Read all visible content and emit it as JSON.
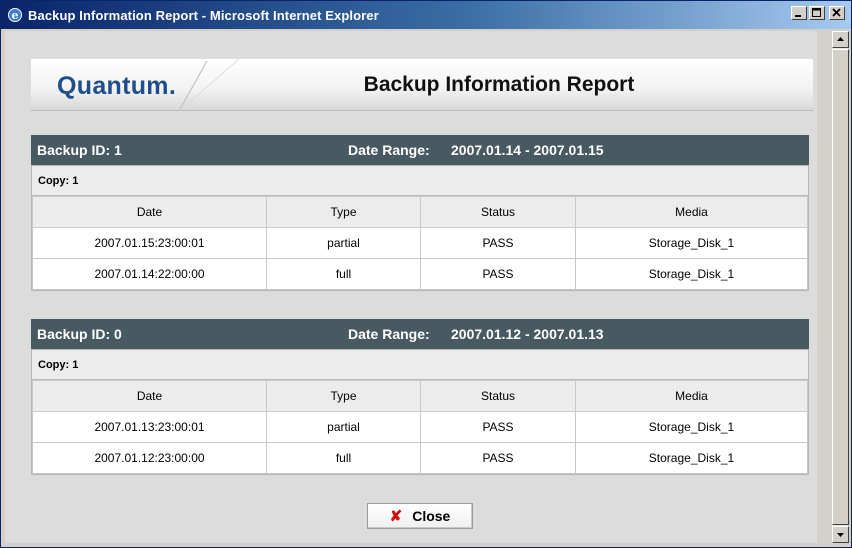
{
  "window": {
    "title": "Backup Information Report - Microsoft Internet Explorer",
    "icon": "ie-icon",
    "controls": [
      "minimize-icon",
      "maximize-icon",
      "close-icon"
    ]
  },
  "header": {
    "logo_text": "Quantum.",
    "report_title": "Backup Information Report"
  },
  "backups": [
    {
      "id_label": "Backup ID: 1",
      "range_label": "Date Range:",
      "range_value": "2007.01.14 - 2007.01.15",
      "copy_label": "Copy: 1",
      "columns": [
        "Date",
        "Type",
        "Status",
        "Media"
      ],
      "rows": [
        [
          "2007.01.15:23:00:01",
          "partial",
          "PASS",
          "Storage_Disk_1"
        ],
        [
          "2007.01.14:22:00:00",
          "full",
          "PASS",
          "Storage_Disk_1"
        ]
      ]
    },
    {
      "id_label": "Backup ID: 0",
      "range_label": "Date Range:",
      "range_value": "2007.01.12 - 2007.01.13",
      "copy_label": "Copy: 1",
      "columns": [
        "Date",
        "Type",
        "Status",
        "Media"
      ],
      "rows": [
        [
          "2007.01.13:23:00:01",
          "partial",
          "PASS",
          "Storage_Disk_1"
        ],
        [
          "2007.01.12:23:00:00",
          "full",
          "PASS",
          "Storage_Disk_1"
        ]
      ]
    }
  ],
  "footer": {
    "close_label": "Close",
    "close_icon": "x-icon"
  },
  "colors": {
    "section_header": "#475a62",
    "logo_blue": "#1f4e8c",
    "close_x_red": "#cc1010"
  }
}
